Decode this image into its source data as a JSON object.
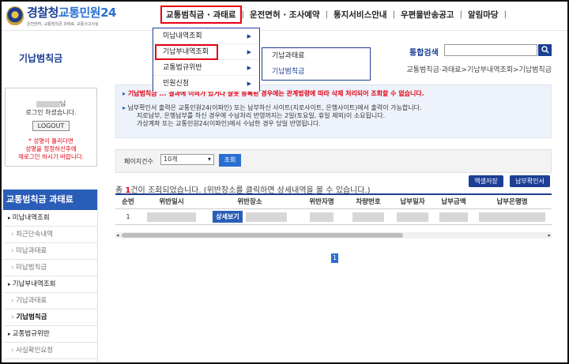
{
  "logo": {
    "title_main": "경찰청",
    "title_accent": "교통민원24",
    "subtitle": "운전면허, 교통범칙금 과태료, 교통사고사실"
  },
  "gnb": {
    "items": [
      "교통범칙금 · 과태료",
      "운전면허 · 조사예약",
      "통지서비스안내",
      "우편물반송공고",
      "알림마당"
    ],
    "sep": "|"
  },
  "page": {
    "title": "기납범칙금",
    "search_label": "통합검색",
    "search_icon": "search-icon",
    "breadcrumb": "교통범칙금·과태료>기납부내역조회>기납범칙금"
  },
  "dropdown": {
    "level1": [
      "미납내역조회",
      "기납부내역조회",
      "교통법규위반",
      "민원신청"
    ],
    "level2": [
      "기납과태료",
      "기납범칙금"
    ]
  },
  "login": {
    "suffix": "님",
    "line2": "로그인 하셨습니다.",
    "logout": "LOGOUT",
    "note": [
      "* 성명이 틀리다면",
      "성명을 정정하신후에",
      "재로그인 하시기 바랍니다."
    ]
  },
  "sidebar": {
    "heading": "교통범칙금 과태료",
    "items": [
      {
        "label": "미납내역조회",
        "kind": "top"
      },
      {
        "label": "최근단속내역",
        "kind": "sub"
      },
      {
        "label": "미납과태료",
        "kind": "sub"
      },
      {
        "label": "미납범칙금",
        "kind": "sub"
      },
      {
        "label": "기납부내역조회",
        "kind": "top"
      },
      {
        "label": "기납과태료",
        "kind": "sub"
      },
      {
        "label": "기납범칙금",
        "kind": "cur"
      },
      {
        "label": "교통법규위반",
        "kind": "top"
      },
      {
        "label": "사실확인요청",
        "kind": "sub"
      }
    ]
  },
  "notice": {
    "line1": "기납범칙금 ... 결과에 이의가 있거나 잘못 등록된 경우에는 관계법령에 따라 삭제 처리되어 조회할 수 없습니다.",
    "line2": "납부확인서 출력은 교통민원24(이파인) 또는 납부하신 사이트(지로사이트, 은행사이트)에서 출력이 가능합니다.",
    "line3": "지로납부, 은행납부를 하신 경우에 수납처리 반영까지는 2일(토요일, 휴일 제외)이 소요됩니다.",
    "line4": "가상계좌 또는 교통민원24(이파인)에서 수납한 경우 당일 반영됩니다."
  },
  "filter": {
    "label": "페이지건수",
    "select_value": "10개",
    "search_button": "조회"
  },
  "results": {
    "count_prefix": "총 ",
    "count": "1",
    "count_suffix": "건이 조회되었습니다. (위반장소를 클릭하면 상세내역을 볼 수 있습니다.)",
    "excel_button": "엑셀저장",
    "receipt_button": "납부확인서"
  },
  "table": {
    "headers": [
      "순번",
      "위반일시",
      "위반장소",
      "위반자명",
      "차량번호",
      "납부일자",
      "납부금액",
      "납부은행명"
    ],
    "rows": [
      {
        "no": "1",
        "detail_button": "상세보기"
      }
    ]
  },
  "pager": {
    "current": "1"
  }
}
